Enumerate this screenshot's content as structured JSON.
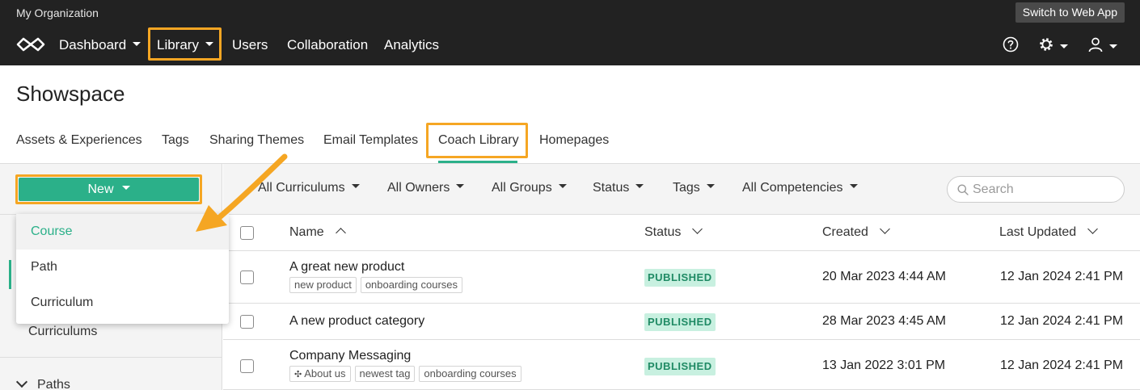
{
  "header": {
    "org_name": "My Organization",
    "switch_label": "Switch to Web App",
    "nav": {
      "dashboard": "Dashboard",
      "library": "Library",
      "users": "Users",
      "collaboration": "Collaboration",
      "analytics": "Analytics"
    },
    "icons": [
      "infinity-logo-icon",
      "help-circle-icon",
      "gear-icon",
      "user-icon"
    ]
  },
  "page": {
    "title": "Showspace",
    "tabs": {
      "assets": "Assets & Experiences",
      "tags": "Tags",
      "sharing": "Sharing Themes",
      "email": "Email Templates",
      "coach": "Coach Library",
      "homepages": "Homepages"
    },
    "active_tab": "Coach Library"
  },
  "sidebar": {
    "new_label": "New",
    "curriculums_link": "Curriculums",
    "paths_section": "Paths"
  },
  "dropdown": {
    "items": [
      "Course",
      "Path",
      "Curriculum"
    ],
    "active": "Course"
  },
  "filters": {
    "curriculums": "All Curriculums",
    "owners": "All Owners",
    "groups": "All Groups",
    "status": "Status",
    "tags": "Tags",
    "competencies": "All Competencies",
    "search_placeholder": "Search"
  },
  "table": {
    "columns": {
      "name": "Name",
      "status": "Status",
      "created": "Created",
      "updated": "Last Updated"
    },
    "rows": [
      {
        "name": "A great new product",
        "tags": [
          "new product",
          "onboarding courses"
        ],
        "status": "PUBLISHED",
        "created": "20 Mar 2023 4:44 AM",
        "updated": "12 Jan 2024 2:41 PM"
      },
      {
        "name": "A new product category",
        "tags": [],
        "status": "PUBLISHED",
        "created": "28 Mar 2023 4:45 AM",
        "updated": "12 Jan 2024 2:41 PM"
      },
      {
        "name": "Company Messaging",
        "tags": [
          "About us",
          "newest tag",
          "onboarding courses"
        ],
        "status": "PUBLISHED",
        "created": "13 Jan 2022 3:01 PM",
        "updated": "12 Jan 2024 2:41 PM"
      }
    ]
  },
  "colors": {
    "accent_green": "#2bb089",
    "highlight_orange": "#f5a623",
    "topbar_bg": "#222222"
  }
}
